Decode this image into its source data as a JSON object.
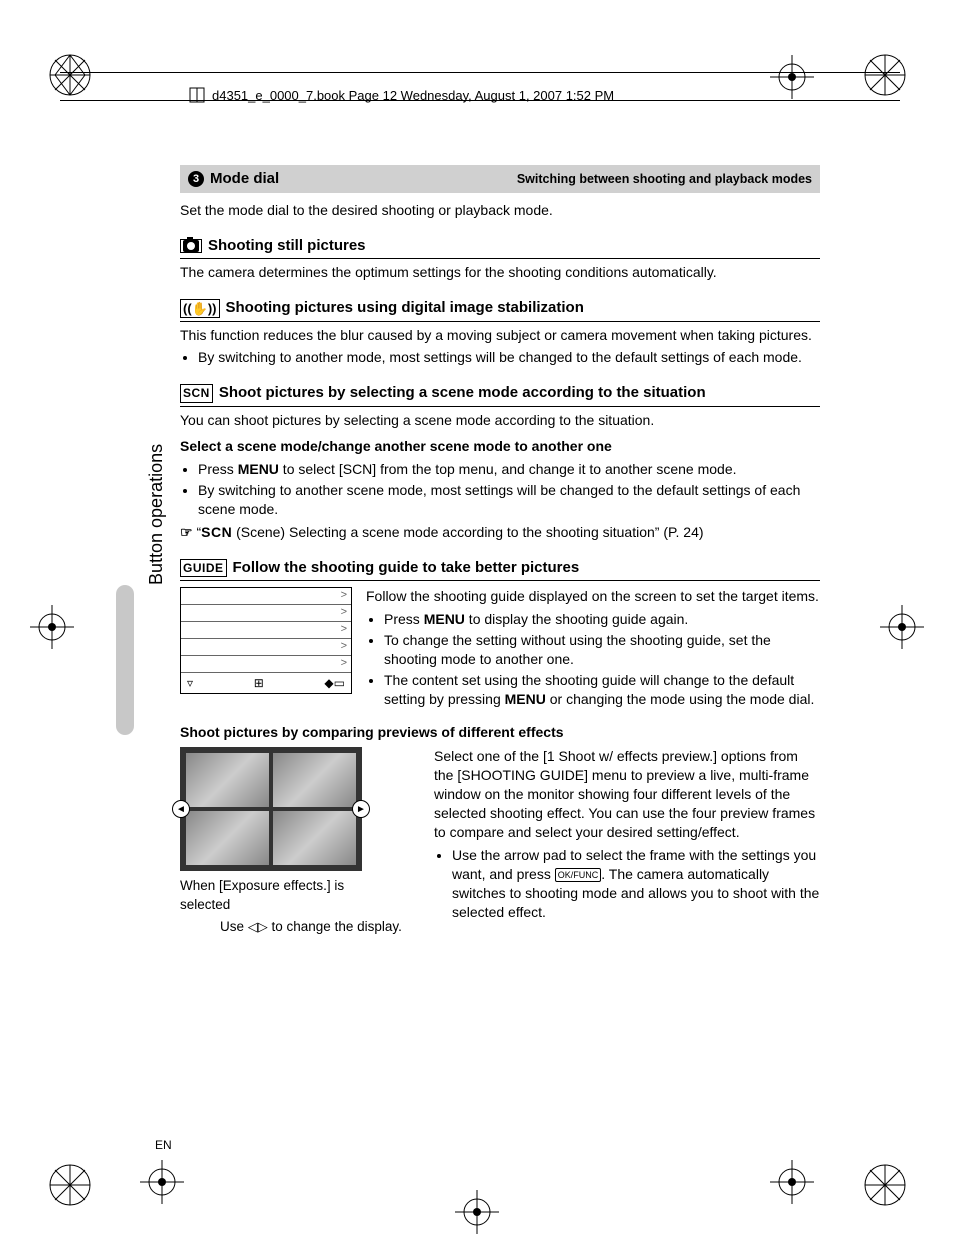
{
  "header": {
    "book_info": "d4351_e_0000_7.book  Page 12  Wednesday, August 1, 2007  1:52 PM"
  },
  "sidebar": {
    "label": "Button operations"
  },
  "section3": {
    "badge": "3",
    "title": "Mode dial",
    "subtitle": "Switching between shooting and playback modes",
    "intro": "Set the mode dial to the desired shooting or playback mode."
  },
  "still": {
    "heading": "Shooting still pictures",
    "body": "The camera determines the optimum settings for the shooting conditions automatically."
  },
  "stab": {
    "heading": "Shooting pictures using digital image stabilization",
    "body": "This function reduces the blur caused by a moving subject or camera movement when taking pictures.",
    "bullet1": "By switching to another mode, most settings will be changed to the default settings of each mode."
  },
  "scn": {
    "icon": "SCN",
    "heading": "Shoot pictures by selecting a scene mode according to the situation",
    "body": "You can shoot pictures by selecting a scene mode according to the situation.",
    "sub_bold": "Select a scene mode/change another scene mode to another one",
    "b1a": "Press ",
    "b1_menu": "MENU",
    "b1b": " to select [SCN] from the top menu, and change it to another scene mode.",
    "b2": "By switching to another scene mode, most settings will be changed to the default settings of each scene mode.",
    "ref_pre": "“",
    "ref_scn": "SCN",
    "ref_post": " (Scene) Selecting a scene mode according to the shooting situation” (P. 24)"
  },
  "guide": {
    "icon": "GUIDE",
    "heading": "Follow the shooting guide to take better pictures",
    "p1": "Follow the shooting guide displayed on the screen to set the target items.",
    "g1a": "Press ",
    "g1_menu": "MENU",
    "g1b": " to display the shooting guide again.",
    "g2": "To change the setting without using the shooting guide, set the shooting mode to another one.",
    "g3a": "The content set using the shooting guide will change to the default setting by pressing ",
    "g3_menu": "MENU",
    "g3b": " or changing the mode using the mode dial."
  },
  "compare": {
    "sub_bold": "Shoot pictures by comparing previews of different effects",
    "p1": "Select one of the [1 Shoot w/ effects preview.] options from the [SHOOTING GUIDE] menu to preview a live, multi-frame window on the monitor showing four different levels of the selected shooting effect. You can use the four preview frames to compare and select your desired setting/effect.",
    "b1a": "Use the arrow pad to select the frame with the settings you want, and press ",
    "b1_ok": "OK/FUNC",
    "b1b": ". The camera automatically switches to shooting mode and allows you to shoot with the selected effect.",
    "cap1": "When [Exposure effects.] is selected",
    "cap2a": "Use ",
    "cap2b": " to change the display."
  },
  "footer": {
    "lang": "EN"
  }
}
